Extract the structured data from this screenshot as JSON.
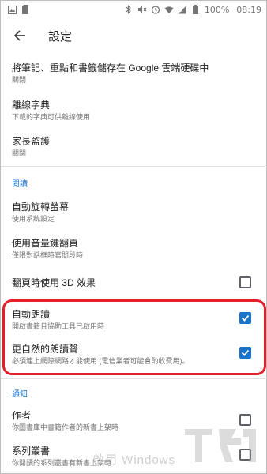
{
  "status_bar": {
    "battery": "100%",
    "time": "08:19",
    "icons": [
      "bluetooth-icon",
      "mute-icon",
      "alarm-icon",
      "wifi-icon",
      "battery-icon"
    ]
  },
  "app_bar": {
    "title": "設定"
  },
  "items": [
    {
      "title": "將筆記、重點和書籤儲存在 Google 雲端硬碟中",
      "subtitle": "關閉"
    },
    {
      "title": "離線字典",
      "subtitle": "下載的字典可供離線使用"
    },
    {
      "title": "家長監護",
      "subtitle": "關閉"
    }
  ],
  "sections": {
    "reading": "閱讀",
    "notifications": "通知"
  },
  "reading_items": [
    {
      "title": "自動旋轉螢幕",
      "subtitle": "使用系統設定"
    },
    {
      "title": "使用音量鍵翻頁",
      "subtitle": "僅限對話框時寫間段時"
    },
    {
      "title": "翻頁時使用 3D 效果",
      "subtitle": "",
      "checked": false
    },
    {
      "title": "自動朗讀",
      "subtitle": "開啟書籍且協助工具已啟用時",
      "checked": true
    },
    {
      "title": "更自然的朗讀聲",
      "subtitle": "必須連上網際網路才能使用 (電信業者可能會酌收費用)。",
      "checked": true
    }
  ],
  "notification_items": [
    {
      "title": "作者",
      "subtitle": "你圖書庫中書籍作者的新書上架時",
      "checked": false
    },
    {
      "title": "系列叢書",
      "subtitle": "你閱讀的系列叢書有新書上架時",
      "checked": false
    }
  ],
  "watermark": {
    "text": "啟用 Windows"
  },
  "colors": {
    "accent": "#1a73c8",
    "highlight": "#e41e2a"
  }
}
